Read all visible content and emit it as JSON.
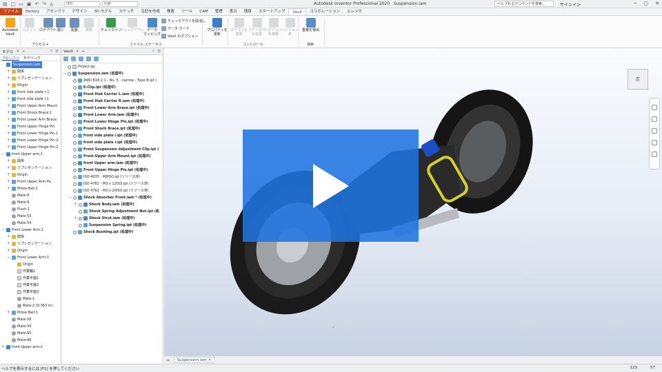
{
  "titlebar": {
    "material": "材料",
    "appearance": "外観",
    "app_title": "Autodesk Inventor Professional 2020",
    "file_name": "Suspension.iam",
    "help_placeholder": "ヘルプおよびコマンドを検索...",
    "signin": "サインイン"
  },
  "tabs": [
    "ファイル",
    "Factory",
    "アセンブリ",
    "デザイン",
    "3D モデル",
    "スケッチ",
    "注記を作成",
    "検査",
    "ツール",
    "CAM",
    "管理",
    "表示",
    "環境",
    "スタートアップ",
    "Vault",
    "コラボレーション",
    "エレメカ"
  ],
  "ribbon": {
    "buttons": [
      {
        "label": "Autodesk\nVault",
        "enabled": true,
        "icon": "vault-logo-icon"
      },
      {
        "label": "ログイン",
        "enabled": false,
        "icon": "login-icon"
      },
      {
        "label": "ログアウト",
        "enabled": true,
        "icon": "logout-icon"
      },
      {
        "label": "開く",
        "enabled": true,
        "icon": "open-icon"
      },
      {
        "label": "配置",
        "enabled": true,
        "icon": "place-icon"
      },
      {
        "label": "更新",
        "enabled": false,
        "icon": "refresh-icon"
      },
      {
        "label": "チェックイン",
        "enabled": true,
        "icon": "checkin-icon"
      },
      {
        "label": "チェックアウト",
        "enabled": false,
        "icon": "checkout-icon"
      },
      {
        "label": "データ\nマッピング",
        "enabled": true,
        "icon": "mapping-icon"
      },
      {
        "label": "プロパティを\n更新",
        "enabled": true,
        "icon": "properties-icon"
      },
      {
        "label": "カテゴリを\n変更",
        "enabled": false,
        "icon": "category-icon"
      },
      {
        "label": "ステータス\nを変更",
        "enabled": false,
        "icon": "status-icon"
      },
      {
        "label": "リビジョン\nを移動",
        "enabled": false,
        "icon": "revision-move-icon"
      },
      {
        "label": "リビジョン\n表",
        "enabled": false,
        "icon": "revision-table-icon"
      },
      {
        "label": "重複を検出",
        "enabled": true,
        "icon": "duplicate-icon"
      }
    ],
    "small_buttons": [
      "チェックアウトを取消し",
      "データ カード",
      "Vault のオプション"
    ],
    "groups": [
      "アクセス ▾",
      "ファイル ステータス",
      "コントロール",
      "検索"
    ]
  },
  "model_panel": {
    "title": "モデル",
    "subtabs": [
      "アセンブリ",
      "モデリング"
    ],
    "rows": [
      {
        "text": "Suspension.iam",
        "level": 0,
        "icon": "asm",
        "selected": true
      },
      {
        "text": "関係",
        "level": 1,
        "icon": "fold",
        "ex": "+"
      },
      {
        "text": "リプレゼンテーション",
        "level": 1,
        "icon": "fold",
        "ex": "+"
      },
      {
        "text": "Origin",
        "level": 1,
        "icon": "fold",
        "ex": "+"
      },
      {
        "text": "front side plate r:1",
        "level": 1,
        "icon": "prt",
        "ex": "+"
      },
      {
        "text": "front side plate l:1",
        "level": 1,
        "icon": "prt",
        "ex": "+"
      },
      {
        "text": "Front Upper Arm Mount",
        "level": 1,
        "icon": "prt",
        "ex": "+"
      },
      {
        "text": "Front Shock Brace:1",
        "level": 1,
        "icon": "prt",
        "ex": "+"
      },
      {
        "text": "Front Lower Arm Brace",
        "level": 1,
        "icon": "prt",
        "ex": "+"
      },
      {
        "text": "Front Upper Hinge Pin",
        "level": 1,
        "icon": "prt",
        "ex": "+"
      },
      {
        "text": "Front Lower Hinge Pin:1",
        "level": 1,
        "icon": "prt",
        "ex": "+"
      },
      {
        "text": "Front Lower Hinge Pin:2",
        "level": 1,
        "icon": "prt",
        "ex": "+"
      },
      {
        "text": "Front Upper Hinge Pin:2",
        "level": 1,
        "icon": "prt",
        "ex": "+"
      },
      {
        "text": "front Upper arm:1",
        "level": 0,
        "icon": "asm",
        "ex": "−"
      },
      {
        "text": "関係",
        "level": 1,
        "icon": "fold",
        "ex": "+"
      },
      {
        "text": "リプレゼンテーション",
        "level": 1,
        "icon": "fold",
        "ex": "+"
      },
      {
        "text": "Origin",
        "level": 1,
        "icon": "fold",
        "ex": "+"
      },
      {
        "text": "Front Upper Arm Pa",
        "level": 1,
        "icon": "prt",
        "ex": "+"
      },
      {
        "text": "Pillow Ball:1",
        "level": 1,
        "icon": "prt",
        "ex": "+"
      },
      {
        "text": "Mate:8",
        "level": 1,
        "icon": "con"
      },
      {
        "text": "Mate:9",
        "level": 1,
        "icon": "con"
      },
      {
        "text": "Flush:1",
        "level": 1,
        "icon": "con"
      },
      {
        "text": "Mate:53",
        "level": 1,
        "icon": "con"
      },
      {
        "text": "Mate:54",
        "level": 1,
        "icon": "con"
      },
      {
        "text": "Front Lower Arm:1",
        "level": 0,
        "icon": "asm",
        "ex": "−"
      },
      {
        "text": "関係",
        "level": 1,
        "icon": "fold",
        "ex": "+"
      },
      {
        "text": "リプレゼンテーション",
        "level": 1,
        "icon": "fold",
        "ex": "+"
      },
      {
        "text": "Origin",
        "level": 1,
        "icon": "fold",
        "ex": "+"
      },
      {
        "text": "Front Lower Arm:1",
        "level": 1,
        "icon": "prt",
        "ex": "−"
      },
      {
        "text": "Origin",
        "level": 2,
        "icon": "fold"
      },
      {
        "text": "作業軸2",
        "level": 2,
        "icon": "doc"
      },
      {
        "text": "作業平面1",
        "level": 2,
        "icon": "doc"
      },
      {
        "text": "作業平面2",
        "level": 2,
        "icon": "doc"
      },
      {
        "text": "作業平面3",
        "level": 2,
        "icon": "doc"
      },
      {
        "text": "Mate:1",
        "level": 2,
        "icon": "con"
      },
      {
        "text": "Mate:2 (0.363 in)",
        "level": 2,
        "icon": "con"
      },
      {
        "text": "Pillow Ball:1",
        "level": 1,
        "icon": "prt",
        "ex": "+"
      },
      {
        "text": "Mate:58",
        "level": 1,
        "icon": "con"
      },
      {
        "text": "Mate:59",
        "level": 1,
        "icon": "con"
      },
      {
        "text": "Mate:65",
        "level": 1,
        "icon": "con"
      },
      {
        "text": "Mate:66",
        "level": 1,
        "icon": "con"
      },
      {
        "text": "front Upper arm:2",
        "level": 0,
        "icon": "asm",
        "ex": "+"
      }
    ]
  },
  "vault_panel": {
    "title": "Vault",
    "rows": [
      {
        "text": "Project.ipj",
        "level": 0,
        "icon": "doc"
      },
      {
        "text": "Suspension.iam (処理中)",
        "level": 0,
        "icon": "asm",
        "ex": "−",
        "bold": true
      },
      {
        "text": "ANSI B18.2.1 - No. 5 - narrow - Type B.ipt (",
        "level": 1,
        "icon": "prt"
      },
      {
        "text": "E-Clip.ipt (処理中)",
        "level": 1,
        "icon": "prt",
        "bold": true
      },
      {
        "text": "Front Hub Carrier L.iam (処理中)",
        "level": 1,
        "icon": "asm",
        "bold": true
      },
      {
        "text": "Front Hub Carrier R.iam (処理中)",
        "level": 1,
        "icon": "asm",
        "bold": true
      },
      {
        "text": "Front Lower Arm Brace.ipt (処理中)",
        "level": 1,
        "icon": "prt",
        "bold": true
      },
      {
        "text": "Front Lower Arm.iam (処理中)",
        "level": 1,
        "icon": "asm",
        "bold": true
      },
      {
        "text": "Front Lower Hinge Pin.ipt (処理中)",
        "level": 1,
        "icon": "prt",
        "bold": true
      },
      {
        "text": "Front Shock Brace.ipt (処理中)",
        "level": 1,
        "icon": "prt",
        "bold": true
      },
      {
        "text": "front side plate l.ipt (処理中)",
        "level": 1,
        "icon": "prt",
        "bold": true
      },
      {
        "text": "front side plate r.ipt (処理中)",
        "level": 1,
        "icon": "prt",
        "bold": true
      },
      {
        "text": "Front Suspension Adjustment Clip.ipt (",
        "level": 1,
        "icon": "prt",
        "bold": true
      },
      {
        "text": "Front Upper Arm Mount.ipt (処理中)",
        "level": 1,
        "icon": "prt",
        "bold": true
      },
      {
        "text": "front Upper arm.iam (処理中)",
        "level": 1,
        "icon": "asm",
        "bold": true
      },
      {
        "text": "Front Upper Hinge Pin.ipt (処理中)",
        "level": 1,
        "icon": "prt",
        "bold": true
      },
      {
        "text": "ISO 4035 - M8ISO.ipt (リリース済)",
        "level": 1,
        "icon": "prt"
      },
      {
        "text": "ISO 4762 - M3 x 12ISO.ipt (リリース済)",
        "level": 1,
        "icon": "prt"
      },
      {
        "text": "ISO 4762 - M3 x 20ISO.ipt (リリース済)",
        "level": 1,
        "icon": "prt"
      },
      {
        "text": "Shock Absorber Front.iam * (処理中)",
        "level": 1,
        "icon": "asm",
        "ex": "−",
        "bold": true
      },
      {
        "text": "Shock Body.iam (処理中)",
        "level": 2,
        "icon": "asm",
        "ex": "+",
        "bold": true
      },
      {
        "text": "Shock Spring Adjustment Nut.ipt (処",
        "level": 2,
        "icon": "prt",
        "bold": true
      },
      {
        "text": "Shock Strut.iam (処理中)",
        "level": 2,
        "icon": "asm",
        "ex": "+",
        "bold": true
      },
      {
        "text": "Suspension Spring.ipt (処理中)",
        "level": 2,
        "icon": "prt",
        "bold": true
      },
      {
        "text": "Shock Bushing.ipt (処理中)",
        "level": 1,
        "icon": "prt",
        "bold": true
      }
    ]
  },
  "viewcube_label": "左",
  "doc_tab": "Suspension.iam",
  "status": {
    "help": "ヘルプを表示するには [F1] を押してください",
    "count1": "123",
    "count2": "57"
  },
  "colors": {
    "file_tab": "#c9441a",
    "selection": "#3f7ed4",
    "play_overlay": "#1f73e0",
    "accent": "#1a4f9c"
  }
}
